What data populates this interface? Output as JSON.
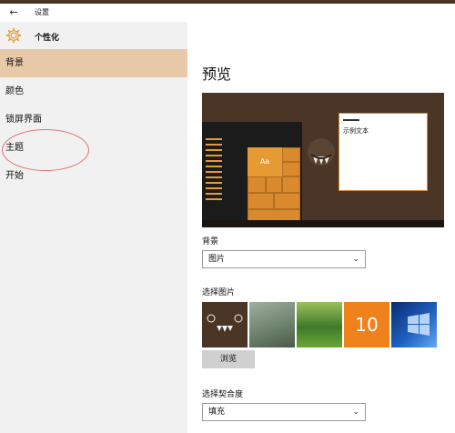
{
  "window": {
    "title": "设置"
  },
  "header": {
    "title": "个性化"
  },
  "sidebar": {
    "items": [
      {
        "label": "背景"
      },
      {
        "label": "颜色"
      },
      {
        "label": "锁屏界面"
      },
      {
        "label": "主题"
      },
      {
        "label": "开始"
      }
    ],
    "active_index": 0
  },
  "main": {
    "heading": "预览",
    "preview": {
      "sample_tile": "Aa",
      "sample_text": "示例文本"
    },
    "background": {
      "label": "背景",
      "selected": "图片"
    },
    "choose_picture": {
      "label": "选择图片",
      "thumb_10_text": "10"
    },
    "browse_button": "浏览",
    "fit": {
      "label": "选择契合度",
      "selected": "填充"
    }
  },
  "colors": {
    "accent": "#e69a34",
    "active_nav": "#e8c9a8",
    "sidebar_bg": "#f1f1f1",
    "preview_bg": "#4a3526",
    "annotation": "#e07070"
  },
  "icons": {
    "back": "back-arrow-icon",
    "settings": "gear-icon",
    "dropdown": "chevron-down-icon"
  }
}
